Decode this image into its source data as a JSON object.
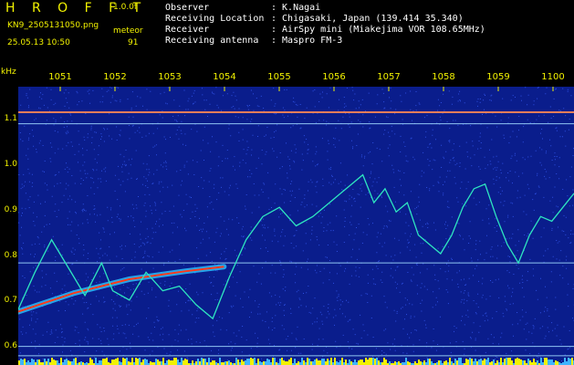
{
  "header": {
    "brand": "H R O F F T",
    "version": "1.0.0f",
    "filename": "KN9_2505131050.png",
    "datetime": "25.05.13 10:50",
    "meteor_label": "meteor",
    "meteor_count": "91",
    "fields": [
      {
        "label": "Observer",
        "value": ": K.Nagai"
      },
      {
        "label": "Receiving Location",
        "value": ": Chigasaki, Japan (139.414 35.340)"
      },
      {
        "label": "Receiver",
        "value": ": AirSpy mini (Miakejima VOR 108.65MHz)"
      },
      {
        "label": "Receiving antenna",
        "value": ": Maspro FM-3"
      }
    ]
  },
  "chart_data": {
    "type": "heatmap",
    "title": "",
    "ylabel": "kHz",
    "xlabel": "",
    "x_tick_labels": [
      "1051",
      "1052",
      "1053",
      "1054",
      "1055",
      "1056",
      "1057",
      "1058",
      "1059",
      "1100"
    ],
    "y_tick_labels": [
      "1.1",
      "1.0",
      "0.9",
      "0.8",
      "0.7",
      "0.6"
    ],
    "ylim": [
      0.58,
      1.18
    ],
    "colors": {
      "background": "#0a1d8c",
      "noise": "#3a60ff",
      "trace": "#2ee6c0",
      "meteor": "#ff3a1a",
      "labels": "#f2f200"
    },
    "horizontal_lines_khz": [
      1.125,
      1.1,
      0.8,
      0.62,
      0.6
    ],
    "meteor_trail": [
      [
        0.0,
        0.695
      ],
      [
        0.1,
        0.735
      ],
      [
        0.2,
        0.765
      ],
      [
        0.3,
        0.782
      ],
      [
        0.37,
        0.792
      ]
    ],
    "doppler_trace": [
      [
        0.0,
        0.7
      ],
      [
        0.03,
        0.78
      ],
      [
        0.06,
        0.85
      ],
      [
        0.09,
        0.79
      ],
      [
        0.12,
        0.73
      ],
      [
        0.15,
        0.8
      ],
      [
        0.17,
        0.74
      ],
      [
        0.2,
        0.72
      ],
      [
        0.23,
        0.78
      ],
      [
        0.26,
        0.74
      ],
      [
        0.29,
        0.75
      ],
      [
        0.32,
        0.71
      ],
      [
        0.35,
        0.68
      ],
      [
        0.38,
        0.77
      ],
      [
        0.41,
        0.85
      ],
      [
        0.44,
        0.9
      ],
      [
        0.47,
        0.92
      ],
      [
        0.5,
        0.88
      ],
      [
        0.53,
        0.9
      ],
      [
        0.56,
        0.93
      ],
      [
        0.58,
        0.95
      ],
      [
        0.6,
        0.97
      ],
      [
        0.62,
        0.99
      ],
      [
        0.64,
        0.93
      ],
      [
        0.66,
        0.96
      ],
      [
        0.68,
        0.91
      ],
      [
        0.7,
        0.93
      ],
      [
        0.72,
        0.86
      ],
      [
        0.74,
        0.84
      ],
      [
        0.76,
        0.82
      ],
      [
        0.78,
        0.86
      ],
      [
        0.8,
        0.92
      ],
      [
        0.82,
        0.96
      ],
      [
        0.84,
        0.97
      ],
      [
        0.86,
        0.9
      ],
      [
        0.88,
        0.84
      ],
      [
        0.9,
        0.8
      ],
      [
        0.92,
        0.86
      ],
      [
        0.94,
        0.9
      ],
      [
        0.96,
        0.89
      ],
      [
        0.98,
        0.92
      ],
      [
        1.0,
        0.95
      ]
    ]
  }
}
